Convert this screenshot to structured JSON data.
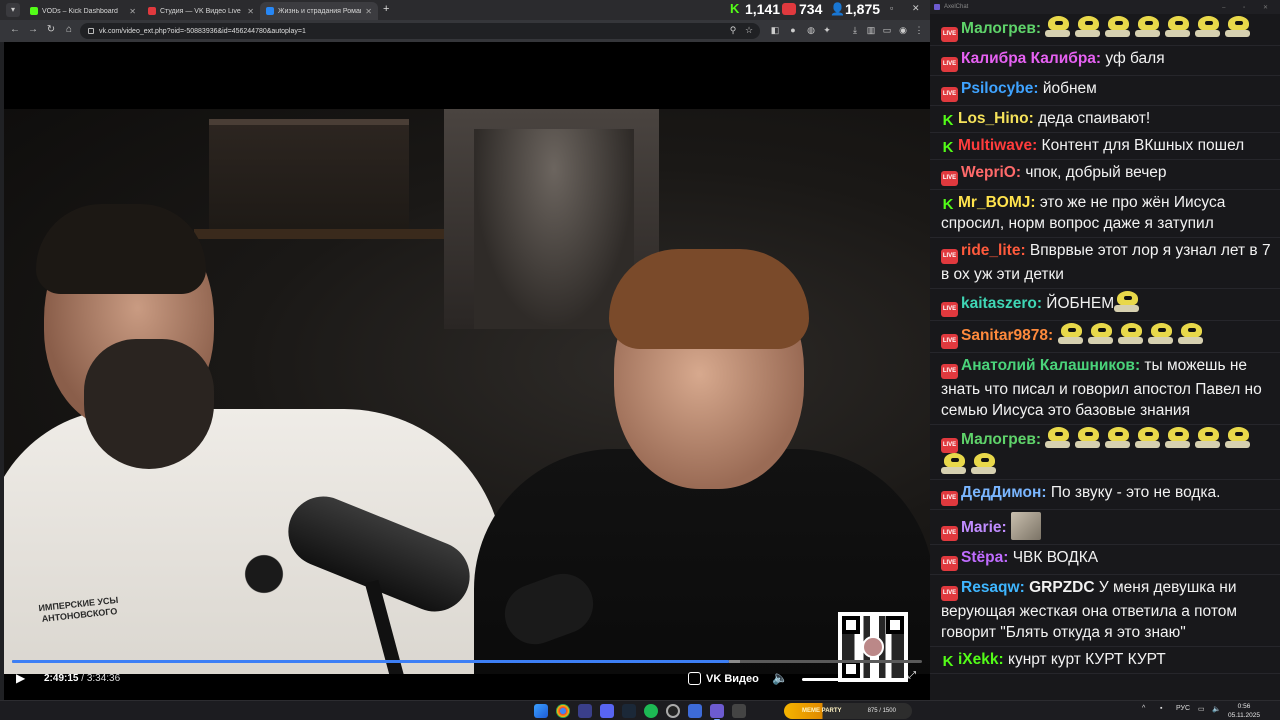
{
  "browser": {
    "tabs": [
      {
        "label": "VODs – Kick Dashboard",
        "favicon_color": "#53fc18"
      },
      {
        "label": "Студия — VK Видео Live",
        "favicon_color": "#e0393e"
      },
      {
        "label": "Жизнь и страдания Романа А",
        "favicon_color": "#2787f5"
      }
    ],
    "url": "vk.com/video_ext.php?oid=-50883936&id=456244780&autoplay=1",
    "stats": {
      "kick_viewers": "1,141",
      "vk_viewers": "734",
      "total_viewers": "1,875"
    }
  },
  "video": {
    "current_time": "2:49:15",
    "duration": "3:34:36",
    "separator": "/",
    "progress_percent": 78.8,
    "buffered_percent": 80,
    "brand": "VK Видео",
    "tee_print": "ИМПЕРСКИЕ УСЫ АНТОНОВСКОГО"
  },
  "chat": {
    "app_title": "AxelChat",
    "messages": [
      {
        "platform": "live",
        "user": "Малогрев",
        "color": "#5fd36a",
        "text": "",
        "emotes": 7
      },
      {
        "platform": "live",
        "user": "Калибра Калибра",
        "color": "#e661f2",
        "text": "уф баля",
        "emotes": 0
      },
      {
        "platform": "live",
        "user": "Psilocybe",
        "color": "#3fa3ff",
        "text": "йобнем",
        "emotes": 0
      },
      {
        "platform": "kick",
        "user": "Los_Hino",
        "color": "#f5e25a",
        "text": "деда спаивают!",
        "emotes": 0
      },
      {
        "platform": "kick",
        "user": "Multiwave",
        "color": "#ff3c3c",
        "text": "Контент для ВКшных пошел",
        "emotes": 0
      },
      {
        "platform": "live",
        "user": "WepriO",
        "color": "#ff6a6a",
        "text": "чпок, добрый вечер",
        "emotes": 0
      },
      {
        "platform": "kick",
        "user": "Mr_BOMJ",
        "color": "#ffe34d",
        "text": "это же не про жён Иисуса спросил, норм вопрос даже я затупил",
        "emotes": 0
      },
      {
        "platform": "live",
        "user": "ride_lite",
        "color": "#ff5a3c",
        "text": "Впврвые этот лор я узнал лет в 7 в ох уж эти детки",
        "emotes": 0
      },
      {
        "platform": "live",
        "user": "kaitaszero",
        "color": "#3fd6b5",
        "text": "ЙОБНЕМ",
        "emotes": 1
      },
      {
        "platform": "live",
        "user": "Sanitar9878",
        "color": "#ff8a3c",
        "text": "",
        "emotes": 5
      },
      {
        "platform": "live",
        "user": "Анатолий Калашников",
        "color": "#4ad37a",
        "text": "ты можешь не знать что писал и говорил апостол Павел но семью Иисуса это базовые знания",
        "emotes": 0
      },
      {
        "platform": "live",
        "user": "Малогрев",
        "color": "#5fd36a",
        "text": "",
        "emotes": 9
      },
      {
        "platform": "live",
        "user": "ДедДимон",
        "color": "#7ab6ff",
        "text": "По звуку - это не водка.",
        "emotes": 0
      },
      {
        "platform": "live",
        "user": "Marie",
        "color": "#c08cff",
        "text": "",
        "emotes": 0,
        "sticker": "cat"
      },
      {
        "platform": "live",
        "user": "Stёpa",
        "color": "#c06cff",
        "text": "ЧВК ВОДКА",
        "emotes": 0
      },
      {
        "platform": "live",
        "user": "Resaqw",
        "color": "#3fb6ff",
        "mention": "GRPZDC",
        "text": "У меня девушка ни верующая жесткая она ответила а потом говорит \"Блять откуда я это знаю\"",
        "emotes": 0
      },
      {
        "platform": "kick",
        "user": "iXekk",
        "color": "#53fc18",
        "text": "кунрт курт КУРТ КУРТ",
        "emotes": 0
      }
    ]
  },
  "taskbar": {
    "meme_widget_title": "MEME PARTY",
    "meme_widget_progress": "875 / 1500",
    "language": "РУС",
    "time": "0:56",
    "date": "05.11.2025"
  },
  "colors": {
    "accent_blue": "#3d7ff5",
    "kick_green": "#53fc18",
    "live_red": "#e0393e"
  }
}
